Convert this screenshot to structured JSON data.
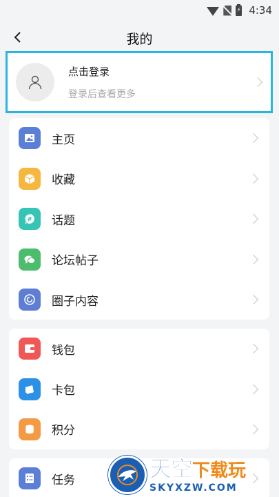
{
  "status_bar": {
    "time": "4:34"
  },
  "header": {
    "title": "我的"
  },
  "login": {
    "title": "点击登录",
    "subtitle": "登录后查看更多"
  },
  "group1": {
    "items": [
      {
        "label": "主页",
        "icon": "image-icon",
        "color": "#5b7fd6"
      },
      {
        "label": "收藏",
        "icon": "box-icon",
        "color": "#f6b740"
      },
      {
        "label": "话题",
        "icon": "hashtag-icon",
        "color": "#36c4b4"
      },
      {
        "label": "论坛帖子",
        "icon": "chat-icon",
        "color": "#4cbd6d"
      },
      {
        "label": "圈子内容",
        "icon": "circle-icon",
        "color": "#5e7ed4"
      }
    ]
  },
  "group2": {
    "items": [
      {
        "label": "钱包",
        "icon": "wallet-icon",
        "color": "#f05858"
      },
      {
        "label": "卡包",
        "icon": "card-icon",
        "color": "#2b91e6"
      },
      {
        "label": "积分",
        "icon": "coins-icon",
        "color": "#f49a45"
      }
    ]
  },
  "group3": {
    "items": [
      {
        "label": "任务",
        "icon": "task-icon",
        "color": "#5b7fd6"
      }
    ]
  },
  "watermark": {
    "brand": "天空",
    "accent": "下载玩",
    "domain": "SKYXZW.COM"
  }
}
